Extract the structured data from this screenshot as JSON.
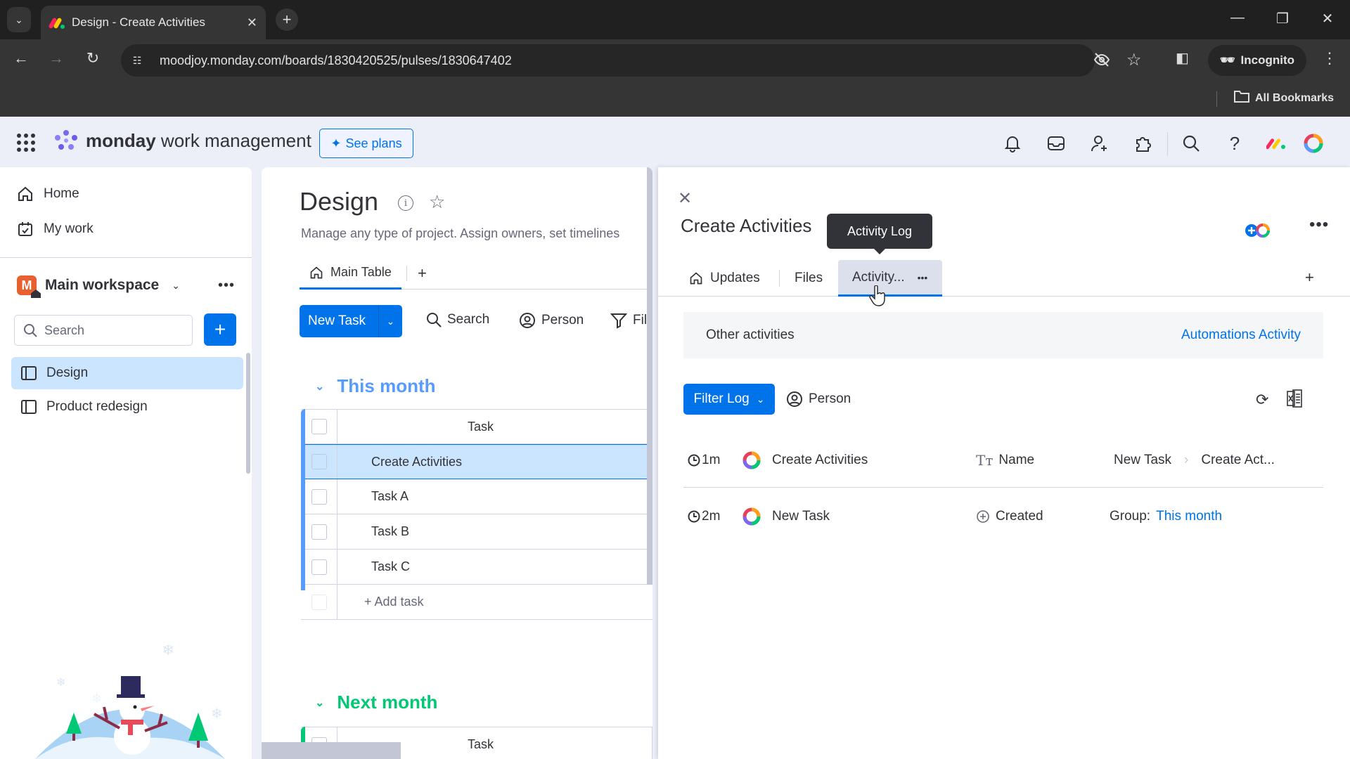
{
  "browser": {
    "tab_title": "Design - Create Activities",
    "url_host": "moodjoy.monday.com",
    "url_path": "/boards/1830420525/pulses/1830647402",
    "incognito_label": "Incognito",
    "all_bookmarks_label": "All Bookmarks"
  },
  "app_header": {
    "brand": "monday",
    "brand_suffix": "work management",
    "see_plans_label": "See plans",
    "icons": [
      "bell-icon",
      "inbox-icon",
      "invite-members-icon",
      "apps-icon",
      "search-icon",
      "help-icon",
      "monday-logo-icon",
      "account-avatar-icon"
    ]
  },
  "sidebar": {
    "nav": [
      {
        "label": "Home",
        "icon": "home-icon"
      },
      {
        "label": "My work",
        "icon": "calendar-check-icon"
      }
    ],
    "workspace": {
      "avatar_letter": "M",
      "name": "Main workspace",
      "avatar_color": "#e8602f"
    },
    "search_placeholder": "Search",
    "boards": [
      {
        "label": "Design",
        "active": true
      },
      {
        "label": "Product redesign",
        "active": false
      }
    ]
  },
  "board": {
    "title": "Design",
    "description": "Manage any type of project. Assign owners, set timelines",
    "view_tab": "Main Table",
    "new_task_label": "New Task",
    "toolbar": {
      "search": "Search",
      "person": "Person",
      "filter": "Filter"
    },
    "groups": [
      {
        "name": "This month",
        "color": "#579bfc",
        "column_header": "Task",
        "rows": [
          "Create Activities",
          "Task A",
          "Task B",
          "Task C"
        ],
        "selected_row": "Create Activities",
        "add_label": "+ Add task"
      },
      {
        "name": "Next month",
        "color": "#00c875",
        "column_header": "Task"
      }
    ]
  },
  "item_panel": {
    "title": "Create Activities",
    "tooltip": "Activity Log",
    "tabs": [
      {
        "label": "Updates",
        "icon": "home-icon"
      },
      {
        "label": "Files"
      },
      {
        "label": "Activity...",
        "active": true
      }
    ],
    "other_activities_label": "Other activities",
    "automations_activity_label": "Automations Activity",
    "filter_log_label": "Filter Log",
    "person_label": "Person",
    "log": [
      {
        "time": "1m",
        "item": "Create Activities",
        "column_icon": "text-type-icon",
        "column": "Name",
        "from": "New Task",
        "to": "Create Act..."
      },
      {
        "time": "2m",
        "item": "New Task",
        "column_icon": "plus-circle-icon",
        "column": "Created",
        "group_label": "Group:",
        "group_value": "This month"
      }
    ]
  }
}
